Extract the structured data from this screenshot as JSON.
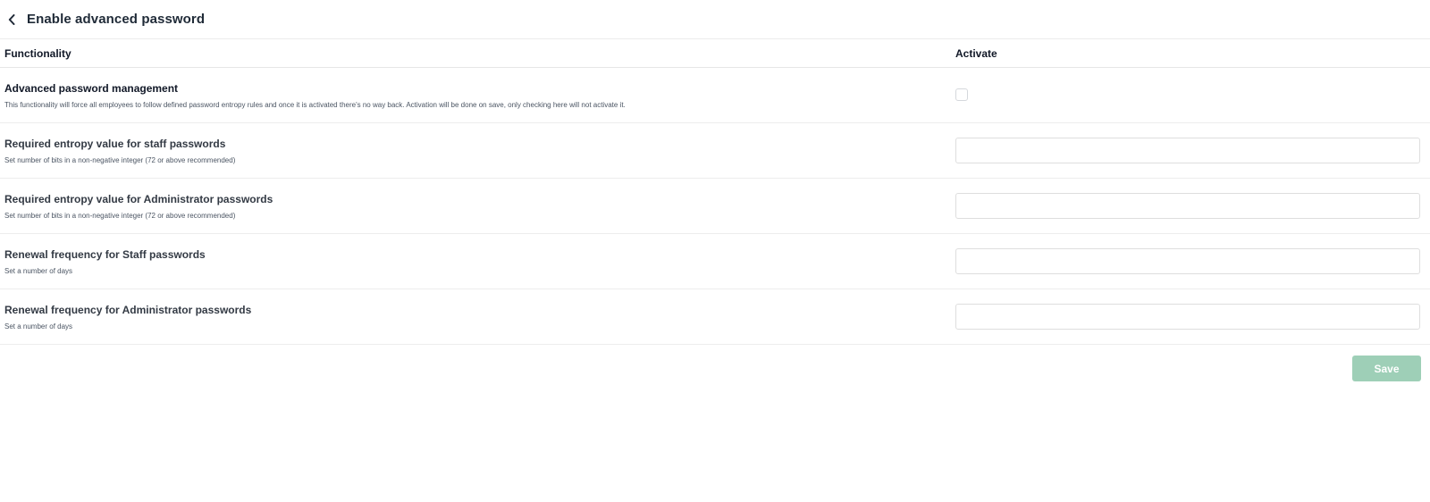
{
  "header": {
    "back_icon": "chevron-left-icon",
    "title": "Enable advanced password"
  },
  "table": {
    "columns": {
      "functionality": "Functionality",
      "activate": "Activate"
    },
    "rows": [
      {
        "title": "Advanced password management",
        "description": "This functionality will force all employees to follow defined password entropy rules and once it is activated there's no way back. Activation will be done on save, only checking here will not activate it.",
        "control": "checkbox",
        "checked": false
      },
      {
        "title": "Required entropy value for staff passwords",
        "description": "Set number of bits in a non-negative integer (72 or above recommended)",
        "control": "text",
        "value": ""
      },
      {
        "title": "Required entropy value for Administrator passwords",
        "description": "Set number of bits in a non-negative integer (72 or above recommended)",
        "control": "text",
        "value": ""
      },
      {
        "title": "Renewal frequency for Staff passwords",
        "description": "Set a number of days",
        "control": "text",
        "value": ""
      },
      {
        "title": "Renewal frequency for Administrator passwords",
        "description": "Set a number of days",
        "control": "text",
        "value": ""
      }
    ]
  },
  "footer": {
    "save_label": "Save",
    "save_color": "#9ecfb7"
  }
}
